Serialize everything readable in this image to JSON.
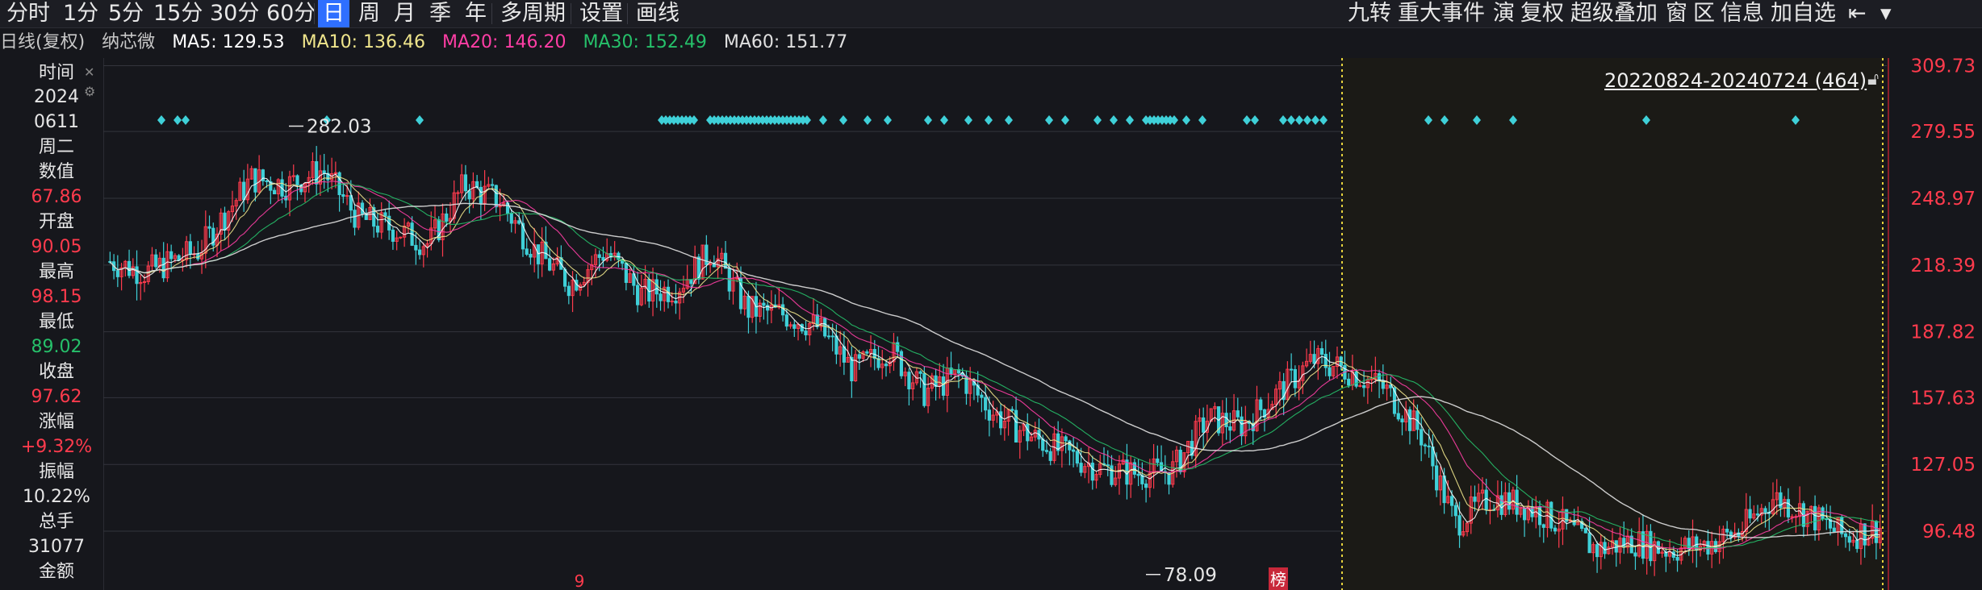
{
  "toolbar": {
    "periods": [
      "分时",
      "1分",
      "5分",
      "15分",
      "30分",
      "60分",
      "日",
      "周",
      "月",
      "季",
      "年",
      "多周期",
      "设置",
      "画线"
    ],
    "active_period": "日",
    "right_items": [
      "九转",
      "重大事件",
      "演",
      "复权",
      "超级叠加",
      "窗",
      "区",
      "信息",
      "加自选"
    ]
  },
  "ma_line": {
    "period_label": "日线(复权)",
    "stock_name": "纳芯微",
    "ma5": "MA5: 129.53",
    "ma10": "MA10: 136.46",
    "ma20": "MA20: 146.20",
    "ma30": "MA30: 152.49",
    "ma60": "MA60: 151.77"
  },
  "info_panel": {
    "time_label": "时间",
    "year": "2024",
    "date": "0611",
    "weekday": "周二",
    "value_label": "数值",
    "value": "67.86",
    "open_label": "开盘",
    "open": "90.05",
    "high_label": "最高",
    "high": "98.15",
    "low_label": "最低",
    "low": "89.02",
    "close_label": "收盘",
    "close": "97.62",
    "change_label": "涨幅",
    "change": "+9.32%",
    "amplitude_label": "振幅",
    "amplitude": "10.22%",
    "volume_label": "总手",
    "volume": "31077",
    "amount_label": "金额"
  },
  "chart": {
    "range_label": "20220824-20240724 (464)",
    "high_annotation": "282.03",
    "low_annotation": "78.09",
    "badge_label": "榜",
    "bottom_marker": "9",
    "colors": {
      "up": "#ff3b4d",
      "down": "#3fd0d8",
      "ma5": "#ffffff",
      "ma10": "#f0e68c",
      "ma20": "#ff3ea5",
      "ma30": "#26c06a",
      "ma60": "#e0e0e0",
      "grid": "#33343c",
      "range_line": "#e6d23c",
      "diamond": "#3fd0d8"
    }
  },
  "chart_data": {
    "type": "candlestick",
    "title": "",
    "yticks": [
      309.73,
      279.55,
      248.97,
      218.39,
      187.82,
      157.63,
      127.05,
      96.48
    ],
    "ylim": [
      71,
      311
    ],
    "grid": true,
    "annotations": [
      {
        "label": "282.03",
        "type": "max"
      },
      {
        "label": "78.09",
        "type": "min"
      }
    ],
    "price_path_x": [
      0,
      0.02,
      0.05,
      0.08,
      0.1,
      0.12,
      0.14,
      0.16,
      0.18,
      0.2,
      0.22,
      0.24,
      0.26,
      0.28,
      0.3,
      0.32,
      0.34,
      0.36,
      0.38,
      0.4,
      0.42,
      0.44,
      0.46,
      0.48,
      0.5,
      0.52,
      0.54,
      0.56,
      0.58,
      0.6,
      0.62,
      0.64,
      0.66,
      0.68,
      0.7,
      0.72,
      0.74,
      0.76,
      0.78,
      0.8,
      0.82,
      0.84,
      0.86,
      0.88,
      0.9,
      0.92,
      0.94,
      0.96,
      0.98,
      1.0
    ],
    "price_path_y": [
      220,
      215,
      225,
      258,
      255,
      262,
      240,
      235,
      228,
      255,
      248,
      225,
      210,
      225,
      205,
      208,
      225,
      198,
      196,
      190,
      170,
      180,
      160,
      168,
      150,
      140,
      132,
      125,
      123,
      124,
      148,
      145,
      160,
      175,
      170,
      162,
      142,
      100,
      112,
      108,
      100,
      88,
      92,
      88,
      90,
      96,
      112,
      104,
      94,
      98
    ],
    "volume_markers": "diamonds along top"
  }
}
